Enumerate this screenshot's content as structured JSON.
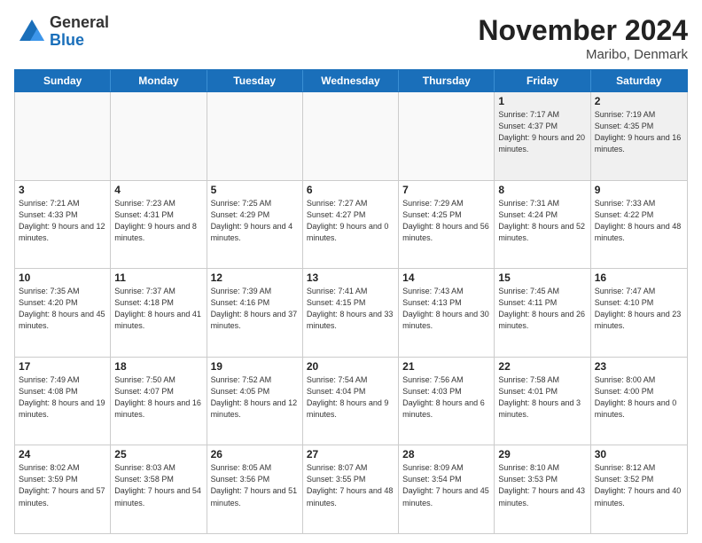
{
  "logo": {
    "general": "General",
    "blue": "Blue"
  },
  "title": "November 2024",
  "location": "Maribo, Denmark",
  "days": [
    "Sunday",
    "Monday",
    "Tuesday",
    "Wednesday",
    "Thursday",
    "Friday",
    "Saturday"
  ],
  "rows": [
    [
      {
        "day": "",
        "info": ""
      },
      {
        "day": "",
        "info": ""
      },
      {
        "day": "",
        "info": ""
      },
      {
        "day": "",
        "info": ""
      },
      {
        "day": "",
        "info": ""
      },
      {
        "day": "1",
        "info": "Sunrise: 7:17 AM\nSunset: 4:37 PM\nDaylight: 9 hours\nand 20 minutes."
      },
      {
        "day": "2",
        "info": "Sunrise: 7:19 AM\nSunset: 4:35 PM\nDaylight: 9 hours\nand 16 minutes."
      }
    ],
    [
      {
        "day": "3",
        "info": "Sunrise: 7:21 AM\nSunset: 4:33 PM\nDaylight: 9 hours\nand 12 minutes."
      },
      {
        "day": "4",
        "info": "Sunrise: 7:23 AM\nSunset: 4:31 PM\nDaylight: 9 hours\nand 8 minutes."
      },
      {
        "day": "5",
        "info": "Sunrise: 7:25 AM\nSunset: 4:29 PM\nDaylight: 9 hours\nand 4 minutes."
      },
      {
        "day": "6",
        "info": "Sunrise: 7:27 AM\nSunset: 4:27 PM\nDaylight: 9 hours\nand 0 minutes."
      },
      {
        "day": "7",
        "info": "Sunrise: 7:29 AM\nSunset: 4:25 PM\nDaylight: 8 hours\nand 56 minutes."
      },
      {
        "day": "8",
        "info": "Sunrise: 7:31 AM\nSunset: 4:24 PM\nDaylight: 8 hours\nand 52 minutes."
      },
      {
        "day": "9",
        "info": "Sunrise: 7:33 AM\nSunset: 4:22 PM\nDaylight: 8 hours\nand 48 minutes."
      }
    ],
    [
      {
        "day": "10",
        "info": "Sunrise: 7:35 AM\nSunset: 4:20 PM\nDaylight: 8 hours\nand 45 minutes."
      },
      {
        "day": "11",
        "info": "Sunrise: 7:37 AM\nSunset: 4:18 PM\nDaylight: 8 hours\nand 41 minutes."
      },
      {
        "day": "12",
        "info": "Sunrise: 7:39 AM\nSunset: 4:16 PM\nDaylight: 8 hours\nand 37 minutes."
      },
      {
        "day": "13",
        "info": "Sunrise: 7:41 AM\nSunset: 4:15 PM\nDaylight: 8 hours\nand 33 minutes."
      },
      {
        "day": "14",
        "info": "Sunrise: 7:43 AM\nSunset: 4:13 PM\nDaylight: 8 hours\nand 30 minutes."
      },
      {
        "day": "15",
        "info": "Sunrise: 7:45 AM\nSunset: 4:11 PM\nDaylight: 8 hours\nand 26 minutes."
      },
      {
        "day": "16",
        "info": "Sunrise: 7:47 AM\nSunset: 4:10 PM\nDaylight: 8 hours\nand 23 minutes."
      }
    ],
    [
      {
        "day": "17",
        "info": "Sunrise: 7:49 AM\nSunset: 4:08 PM\nDaylight: 8 hours\nand 19 minutes."
      },
      {
        "day": "18",
        "info": "Sunrise: 7:50 AM\nSunset: 4:07 PM\nDaylight: 8 hours\nand 16 minutes."
      },
      {
        "day": "19",
        "info": "Sunrise: 7:52 AM\nSunset: 4:05 PM\nDaylight: 8 hours\nand 12 minutes."
      },
      {
        "day": "20",
        "info": "Sunrise: 7:54 AM\nSunset: 4:04 PM\nDaylight: 8 hours\nand 9 minutes."
      },
      {
        "day": "21",
        "info": "Sunrise: 7:56 AM\nSunset: 4:03 PM\nDaylight: 8 hours\nand 6 minutes."
      },
      {
        "day": "22",
        "info": "Sunrise: 7:58 AM\nSunset: 4:01 PM\nDaylight: 8 hours\nand 3 minutes."
      },
      {
        "day": "23",
        "info": "Sunrise: 8:00 AM\nSunset: 4:00 PM\nDaylight: 8 hours\nand 0 minutes."
      }
    ],
    [
      {
        "day": "24",
        "info": "Sunrise: 8:02 AM\nSunset: 3:59 PM\nDaylight: 7 hours\nand 57 minutes."
      },
      {
        "day": "25",
        "info": "Sunrise: 8:03 AM\nSunset: 3:58 PM\nDaylight: 7 hours\nand 54 minutes."
      },
      {
        "day": "26",
        "info": "Sunrise: 8:05 AM\nSunset: 3:56 PM\nDaylight: 7 hours\nand 51 minutes."
      },
      {
        "day": "27",
        "info": "Sunrise: 8:07 AM\nSunset: 3:55 PM\nDaylight: 7 hours\nand 48 minutes."
      },
      {
        "day": "28",
        "info": "Sunrise: 8:09 AM\nSunset: 3:54 PM\nDaylight: 7 hours\nand 45 minutes."
      },
      {
        "day": "29",
        "info": "Sunrise: 8:10 AM\nSunset: 3:53 PM\nDaylight: 7 hours\nand 43 minutes."
      },
      {
        "day": "30",
        "info": "Sunrise: 8:12 AM\nSunset: 3:52 PM\nDaylight: 7 hours\nand 40 minutes."
      }
    ]
  ]
}
